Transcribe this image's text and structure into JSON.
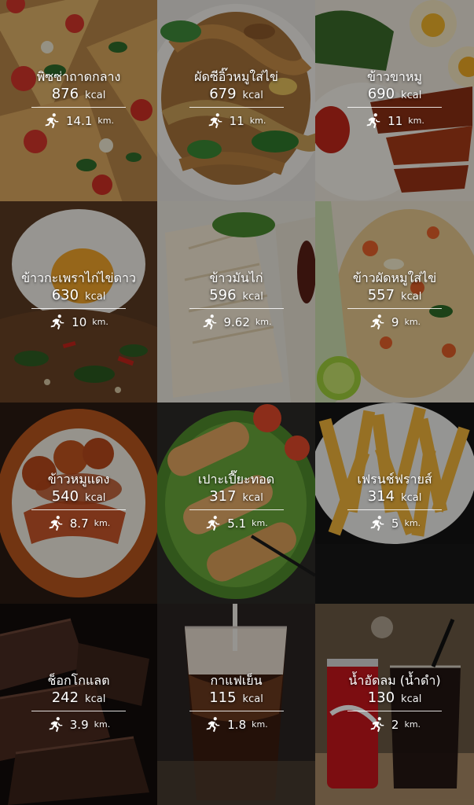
{
  "items": [
    {
      "name": "พิซซ่าถาดกลาง",
      "kcal": "876",
      "km": "14.1",
      "scene": "pizza"
    },
    {
      "name": "ผัดซีอิ๊วหมูใส่ไข่",
      "kcal": "679",
      "km": "11",
      "scene": "noodle"
    },
    {
      "name": "ข้าวขาหมู",
      "kcal": "690",
      "km": "11",
      "scene": "porkleg"
    },
    {
      "name": "ข้าวกะเพราไก่ไข่ดาว",
      "kcal": "630",
      "km": "10",
      "scene": "krapao"
    },
    {
      "name": "ข้าวมันไก่",
      "kcal": "596",
      "km": "9.62",
      "scene": "chickenrice"
    },
    {
      "name": "ข้าวผัดหมูใส่ไข่",
      "kcal": "557",
      "km": "9",
      "scene": "friedrice"
    },
    {
      "name": "ข้าวหมูแดง",
      "kcal": "540",
      "km": "8.7",
      "scene": "redpork"
    },
    {
      "name": "เปาะเปี๊ยะทอด",
      "kcal": "317",
      "km": "5.1",
      "scene": "springroll"
    },
    {
      "name": "เฟรนช์ฟรายส์",
      "kcal": "314",
      "km": "5",
      "scene": "fries"
    },
    {
      "name": "ช็อกโกแลต",
      "kcal": "242",
      "km": "3.9",
      "scene": "chocolate"
    },
    {
      "name": "กาแฟเย็น",
      "kcal": "115",
      "km": "1.8",
      "scene": "icedcoffee"
    },
    {
      "name": "น้ำอัดลม (น้ำดำ)",
      "kcal": "130",
      "km": "2",
      "scene": "cola"
    }
  ],
  "units": {
    "kcal": "kcal",
    "km": "km."
  }
}
